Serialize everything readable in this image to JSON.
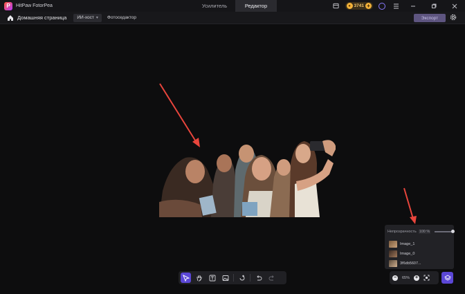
{
  "app": {
    "title": "HitPaw FotorPea",
    "logo_letter": "P"
  },
  "tabs": [
    {
      "label": "Усилитель",
      "active": false
    },
    {
      "label": "Редактор",
      "active": true
    }
  ],
  "titlebar": {
    "coins": "3741",
    "coin_symbol": "●",
    "coin_plus": "+"
  },
  "toolbar": {
    "home_label": "Домашняя страница",
    "mode_dropdown": "ИИ-хост",
    "breadcrumb": "Фотоседактор",
    "export_label": "Экспорт"
  },
  "layers_panel": {
    "opacity_label": "Непрозрачность",
    "opacity_value": "100 %",
    "opacity_level": 1.0,
    "items": [
      {
        "name": "Image_1"
      },
      {
        "name": "Image_0"
      },
      {
        "name": "3f6db5607..."
      }
    ]
  },
  "zoom": {
    "value": "65%",
    "minus": "−",
    "plus": "+"
  },
  "colors": {
    "accent": "#5b47d6",
    "export_bg": "#5e5580",
    "arrow": "#e8453c",
    "coin": "#f2b23a"
  },
  "icons": [
    "home-icon",
    "settings-icon",
    "select-tool-icon",
    "hand-tool-icon",
    "text-tool-icon",
    "image-tool-icon",
    "rotate-icon",
    "undo-icon",
    "redo-icon",
    "fit-screen-icon",
    "layers-icon",
    "user-icon",
    "menu-icon",
    "minimize-icon",
    "maximize-icon",
    "close-icon",
    "gift-icon"
  ]
}
